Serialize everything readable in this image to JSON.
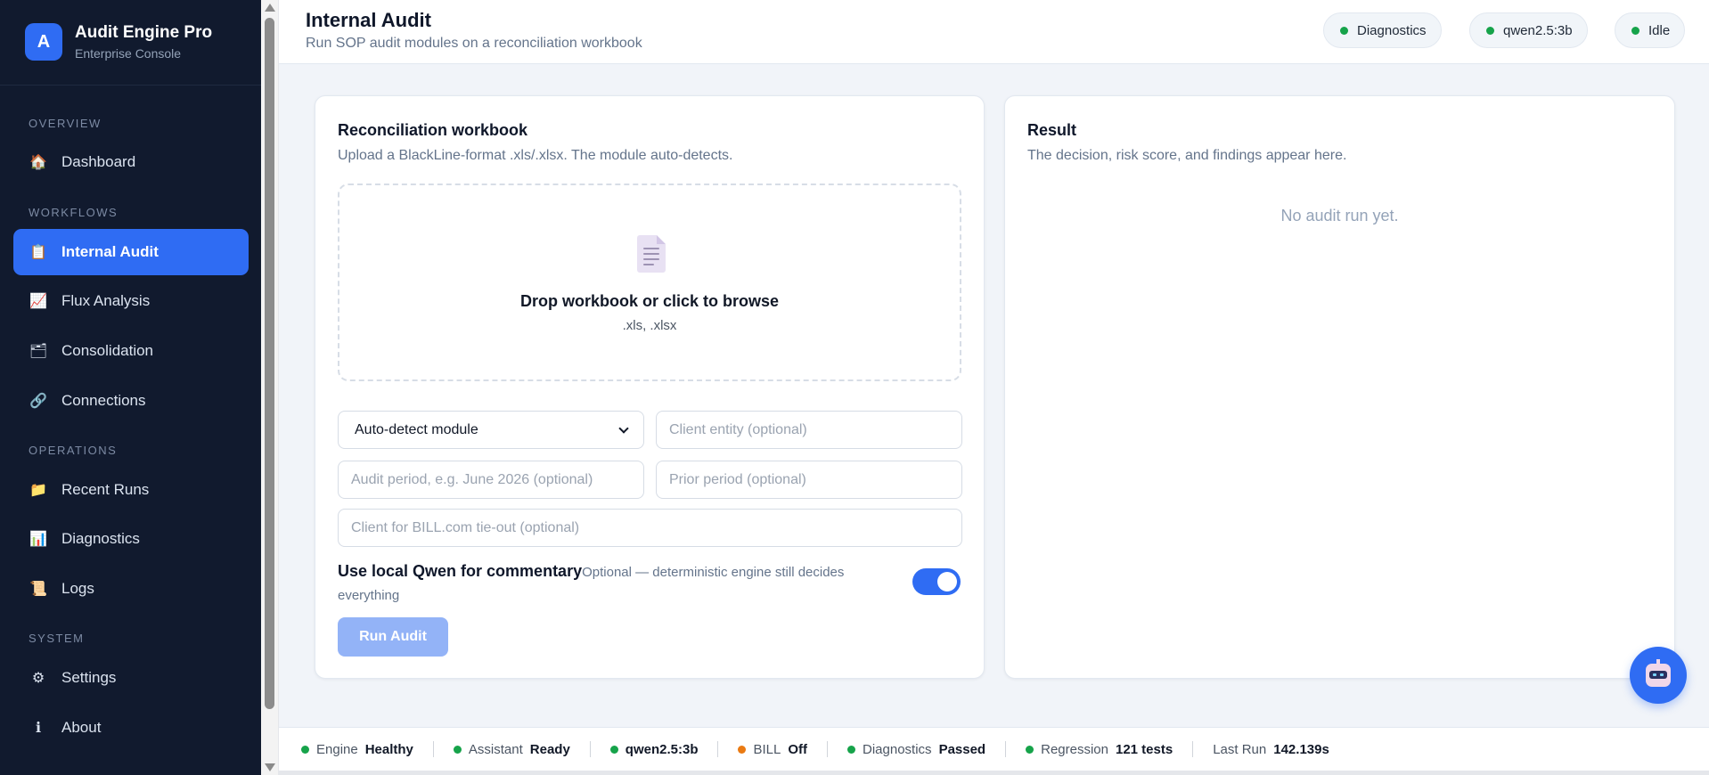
{
  "brand": {
    "logo_letter": "A",
    "title": "Audit Engine Pro",
    "subtitle": "Enterprise Console",
    "accent": "#2f6cf3"
  },
  "sidebar": {
    "sections": [
      {
        "label": "OVERVIEW",
        "items": [
          {
            "label": "Dashboard",
            "icon": "house-icon",
            "glyph": "🏠"
          }
        ]
      },
      {
        "label": "WORKFLOWS",
        "items": [
          {
            "label": "Internal Audit",
            "icon": "clipboard-icon",
            "glyph": "📋",
            "active": true
          },
          {
            "label": "Flux Analysis",
            "icon": "chart-increasing-icon",
            "glyph": "📈"
          },
          {
            "label": "Consolidation",
            "icon": "card-index-dividers-icon",
            "glyph": "🗂"
          },
          {
            "label": "Connections",
            "icon": "link-icon",
            "glyph": "🔗"
          }
        ]
      },
      {
        "label": "OPERATIONS",
        "items": [
          {
            "label": "Recent Runs",
            "icon": "folder-icon",
            "glyph": "📁"
          },
          {
            "label": "Diagnostics",
            "icon": "bar-chart-icon",
            "glyph": "📊"
          },
          {
            "label": "Logs",
            "icon": "scroll-icon",
            "glyph": "📜"
          }
        ]
      },
      {
        "label": "SYSTEM",
        "items": [
          {
            "label": "Settings",
            "icon": "gear-icon",
            "glyph": "⚙"
          },
          {
            "label": "About",
            "icon": "info-icon",
            "glyph": "ℹ"
          }
        ]
      }
    ]
  },
  "header": {
    "title": "Internal Audit",
    "subtitle": "Run SOP audit modules on a reconciliation workbook",
    "pills": [
      {
        "label": "Diagnostics",
        "status_color": "#16a34a"
      },
      {
        "label": "qwen2.5:3b",
        "status_color": "#16a34a"
      },
      {
        "label": "Idle",
        "status_color": "#16a34a"
      }
    ]
  },
  "workbook_card": {
    "title": "Reconciliation workbook",
    "subtitle": "Upload a BlackLine-format .xls/.xlsx. The module auto-detects.",
    "dropzone": {
      "title": "Drop workbook or click to browse",
      "hint": ".xls, .xlsx",
      "icon": "document-icon"
    },
    "module_select": {
      "value": "Auto-detect module"
    },
    "fields": {
      "client_entity": "Client entity (optional)",
      "audit_period": "Audit period, e.g. June 2026 (optional)",
      "prior_period": "Prior period (optional)",
      "bill_client": "Client for BILL.com tie-out (optional)"
    },
    "qwen_toggle": {
      "title": "Use local Qwen for commentary",
      "description": "Optional — deterministic engine still decides everything",
      "enabled": true
    },
    "run_button": "Run Audit"
  },
  "result_card": {
    "title": "Result",
    "subtitle": "The decision, risk score, and findings appear here.",
    "empty_message": "No audit run yet."
  },
  "status_bar": [
    {
      "label": "Engine",
      "value": "Healthy",
      "status_color": "#16a34a"
    },
    {
      "label": "Assistant",
      "value": "Ready",
      "status_color": "#16a34a"
    },
    {
      "label": "",
      "value": "qwen2.5:3b",
      "status_color": "#16a34a"
    },
    {
      "label": "BILL",
      "value": "Off",
      "status_color": "#ea7a12"
    },
    {
      "label": "Diagnostics",
      "value": "Passed",
      "status_color": "#16a34a"
    },
    {
      "label": "Regression",
      "value": "121 tests",
      "status_color": "#16a34a"
    },
    {
      "label": "Last Run",
      "value": "142.139s",
      "status_color": null
    }
  ]
}
